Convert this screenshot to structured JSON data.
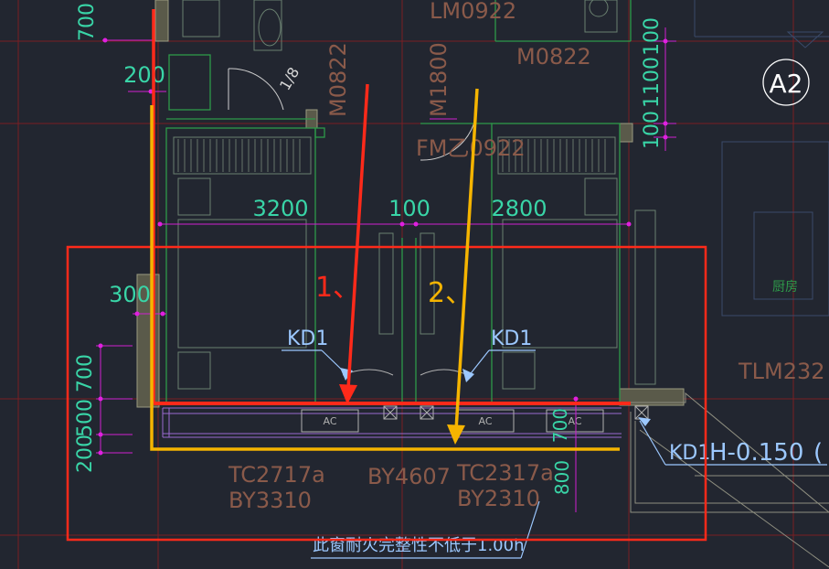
{
  "drawing": {
    "dimensions": {
      "d700_top": "700",
      "d200": "200",
      "d3200": "3200",
      "d100": "100",
      "d2800": "2800",
      "d300": "300",
      "d700_left": "700",
      "d500": "500",
      "d200_bottom": "200",
      "d700_right": "700",
      "d800": "800",
      "r100a": "100",
      "r1100": "1100",
      "r100b": "100"
    },
    "labels": {
      "door_lm0922": "LM0922",
      "door_m0822_top": "M0822",
      "door_m0822_left": "M0822",
      "door_m1800": "M1800",
      "door_fm0922": "FM乙0922",
      "grid_a2": "A2",
      "kd1_left": "KD1",
      "kd1_mid": "KD1",
      "kd1_right": "KD1",
      "ac_left": "AC",
      "ac_mid": "AC",
      "ac_right": "AC",
      "tlm232": "TLM232",
      "elevation": "H-0.150",
      "elevation_cont": "(",
      "tc2717": "TC2717a",
      "by3310": "BY3310",
      "by4607": "BY4607",
      "tc2317": "TC2317a",
      "by2310": "BY2310",
      "fire_note": "此窗耐火完整性不低于1.00h",
      "door_swing": "1/8",
      "room_tag": "厨房"
    },
    "annotations": {
      "arrow1": "1、",
      "arrow2": "2、"
    },
    "colors": {
      "background": "#222630",
      "red_annotation": "#ff2a1a",
      "orange_annotation": "#f5b400",
      "dimension_text": "#39d5a7",
      "magenta": "#e020e0",
      "wall_gray": "#8f8f7a",
      "label_brown": "#8a5a4a",
      "label_blue": "#9cc8ff",
      "grid_red": "#a02020"
    }
  }
}
